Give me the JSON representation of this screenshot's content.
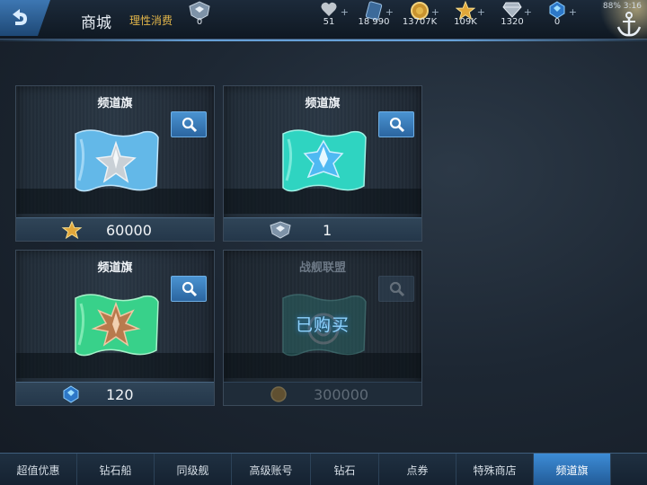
{
  "header": {
    "title": "商城",
    "subtitle": "理性消费",
    "back_icon": "back-arrow-icon"
  },
  "resources": [
    {
      "name": "rank-badge",
      "icon": "shield-badge-icon",
      "value": "0",
      "plus": ""
    },
    {
      "name": "stamina",
      "icon": "heart-icon",
      "value": "51",
      "plus": "+"
    },
    {
      "name": "blueprint",
      "icon": "book-icon",
      "value": "18 990",
      "plus": "+"
    },
    {
      "name": "coins",
      "icon": "coin-icon",
      "value": "13707K",
      "plus": "+"
    },
    {
      "name": "star-points",
      "icon": "star-icon",
      "value": "109K",
      "plus": "+"
    },
    {
      "name": "diamonds",
      "icon": "diamond-icon",
      "value": "1320",
      "plus": "+"
    },
    {
      "name": "crystals",
      "icon": "crystal-icon",
      "value": "0",
      "plus": "+"
    }
  ],
  "status": {
    "battery": "88%",
    "time": "3:16"
  },
  "cards": [
    {
      "name": "频道旗",
      "flag_color": "#63b8e8",
      "emblem": "silver-star",
      "price_icon": "gold-star-icon",
      "price": "60000",
      "purchased": ""
    },
    {
      "name": "频道旗",
      "flag_color": "#2fd4c1",
      "emblem": "blue-crystal",
      "price_icon": "shield-badge-icon",
      "price": "1",
      "purchased": ""
    },
    {
      "name": "频道旗",
      "flag_color": "#38d18a",
      "emblem": "bronze-star",
      "price_icon": "crystal-icon",
      "price": "120",
      "purchased": ""
    },
    {
      "name": "战舰联盟",
      "flag_color": "#2f7a76",
      "emblem": "target",
      "price_icon": "coin-icon",
      "price": "300000",
      "purchased": "已购买"
    }
  ],
  "tabs": [
    {
      "label": "超值优惠",
      "active": false
    },
    {
      "label": "钻石船",
      "active": false
    },
    {
      "label": "同级舰",
      "active": false
    },
    {
      "label": "高级账号",
      "active": false
    },
    {
      "label": "钻石",
      "active": false
    },
    {
      "label": "点券",
      "active": false
    },
    {
      "label": "特殊商店",
      "active": false
    },
    {
      "label": "频道旗",
      "active": true
    }
  ],
  "colors": {
    "accent": "#3d8cd6",
    "gold": "#e3b64a"
  }
}
